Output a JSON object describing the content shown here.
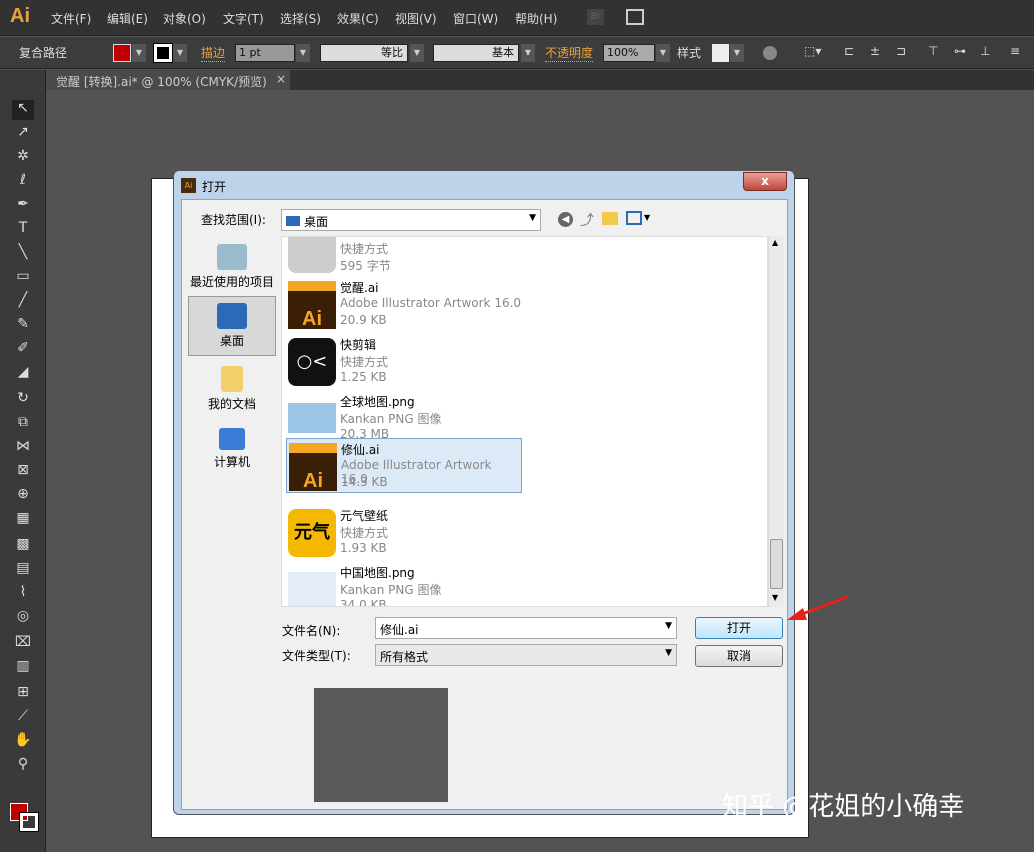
{
  "app": {
    "logo": "Ai",
    "menus": [
      "文件(F)",
      "编辑(E)",
      "对象(O)",
      "文字(T)",
      "选择(S)",
      "效果(C)",
      "视图(V)",
      "窗口(W)",
      "帮助(H)"
    ],
    "bridge": "Br"
  },
  "control": {
    "selection": "复合路径",
    "fill_color": "#c00000",
    "stroke_label": "描边",
    "stroke_value": "1 pt",
    "profile": "等比",
    "brush": "基本",
    "opacity_label": "不透明度",
    "opacity": "100%",
    "style_label": "样式"
  },
  "document": {
    "tab": "觉醒 [转换].ai* @ 100% (CMYK/预览)",
    "close": "×"
  },
  "dialog": {
    "title": "打开",
    "close": "x",
    "lookin_label": "查找范围(I):",
    "lookin_value": "桌面",
    "places": [
      "最近使用的项目",
      "桌面",
      "我的文档",
      "计算机"
    ],
    "files": [
      {
        "name": "",
        "type": "快捷方式",
        "size": "595 字节",
        "icon": "shortcut"
      },
      {
        "name": "觉醒.ai",
        "type": "Adobe Illustrator Artwork 16.0",
        "size": "20.9 KB",
        "icon": "ai-file"
      },
      {
        "name": "快剪辑",
        "type": "快捷方式",
        "size": "1.25 KB",
        "icon": "app-shortcut"
      },
      {
        "name": "全球地图.png",
        "type": "Kankan PNG 图像",
        "size": "20.3 MB",
        "icon": "image"
      },
      {
        "name": "修仙.ai",
        "type": "Adobe Illustrator Artwork 16.0",
        "size": "14.3 KB",
        "icon": "ai-file",
        "selected": true
      },
      {
        "name": "元气壁纸",
        "type": "快捷方式",
        "size": "1.93 KB",
        "icon": "app-shortcut"
      },
      {
        "name": "中国地图.png",
        "type": "Kankan PNG 图像",
        "size": "34.0 KB",
        "icon": "image"
      }
    ],
    "filename_label": "文件名(N):",
    "filename_value": "修仙.ai",
    "filetype_label": "文件类型(T):",
    "filetype_value": "所有格式",
    "open": "打开",
    "cancel": "取消"
  },
  "watermark": "知乎 @花姐的小确幸"
}
